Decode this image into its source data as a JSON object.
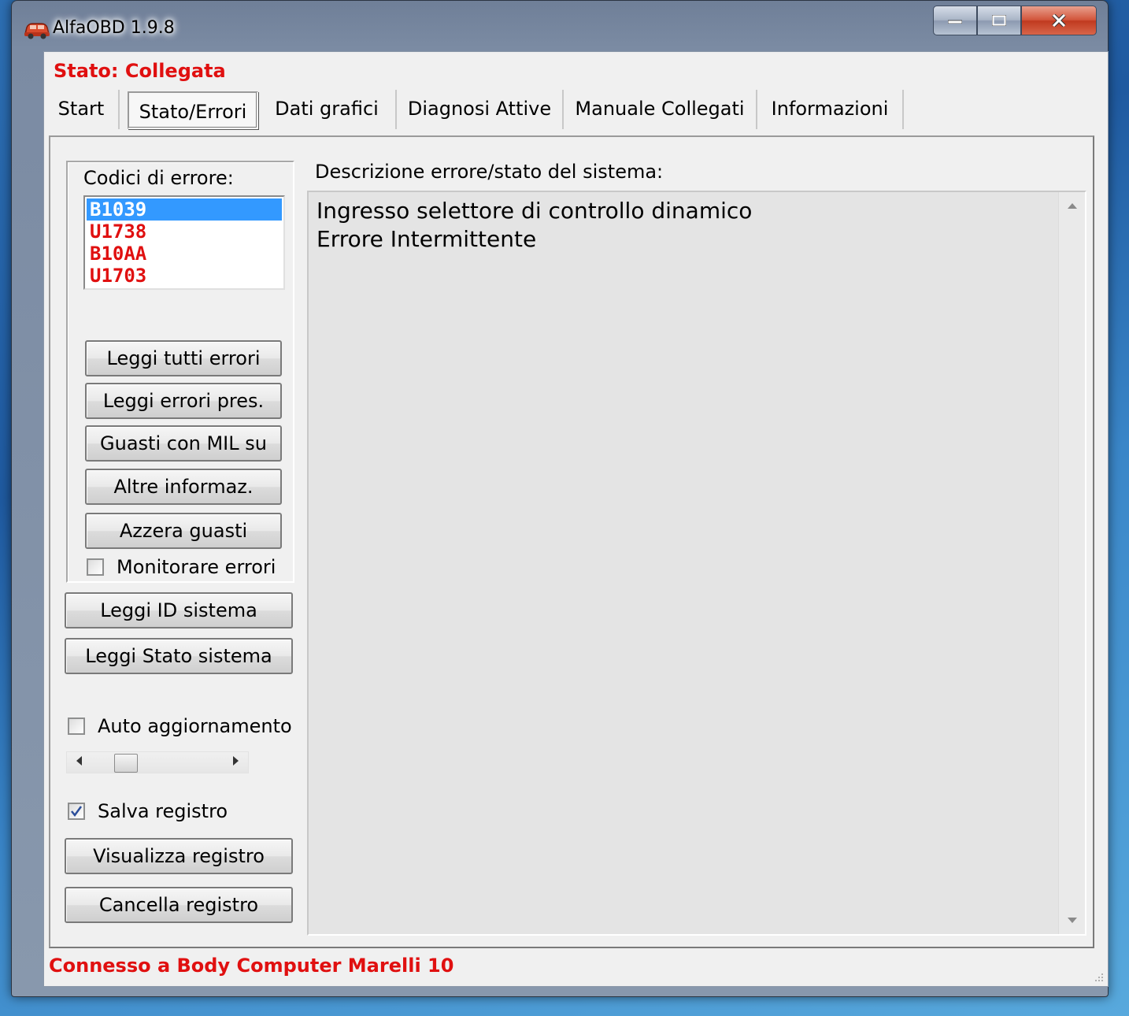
{
  "window": {
    "title": "AlfaOBD 1.9.8"
  },
  "status": {
    "top": "Stato: Collegata",
    "bottom": "Connesso a Body Computer Marelli 10"
  },
  "tabs": [
    {
      "label": "Start",
      "active": false
    },
    {
      "label": "Stato/Errori",
      "active": true
    },
    {
      "label": "Dati grafici",
      "active": false
    },
    {
      "label": "Diagnosi Attive",
      "active": false
    },
    {
      "label": "Manuale Collegati",
      "active": false
    },
    {
      "label": "Informazioni",
      "active": false
    }
  ],
  "error_group": {
    "title": "Codici di errore:",
    "codes": [
      {
        "code": "B1039",
        "selected": true
      },
      {
        "code": "U1738",
        "selected": false
      },
      {
        "code": "B10AA",
        "selected": false
      },
      {
        "code": "U1703",
        "selected": false
      }
    ],
    "buttons": {
      "read_all": "Leggi tutti errori",
      "read_present": "Leggi errori pres.",
      "mil_on": "Guasti con MIL su",
      "more_info": "Altre informaz.",
      "clear": "Azzera guasti"
    },
    "monitor": {
      "label": "Monitorare errori",
      "checked": false
    }
  },
  "actions": {
    "read_id": "Leggi ID sistema",
    "read_state": "Leggi Stato sistema",
    "auto_update": {
      "label": "Auto aggiornamento",
      "checked": false
    },
    "update_slider": {
      "level": 0.2
    },
    "save_log": {
      "label": "Salva registro",
      "checked": true
    },
    "view_log": "Visualizza registro",
    "delete_log": "Cancella registro"
  },
  "description": {
    "label": "Descrizione errore/stato del sistema:",
    "line1": "Ingresso selettore di controllo dinamico",
    "line2": "Errore Intermittente"
  },
  "colors": {
    "error_red": "#e01010",
    "selection_blue": "#3399ff"
  }
}
